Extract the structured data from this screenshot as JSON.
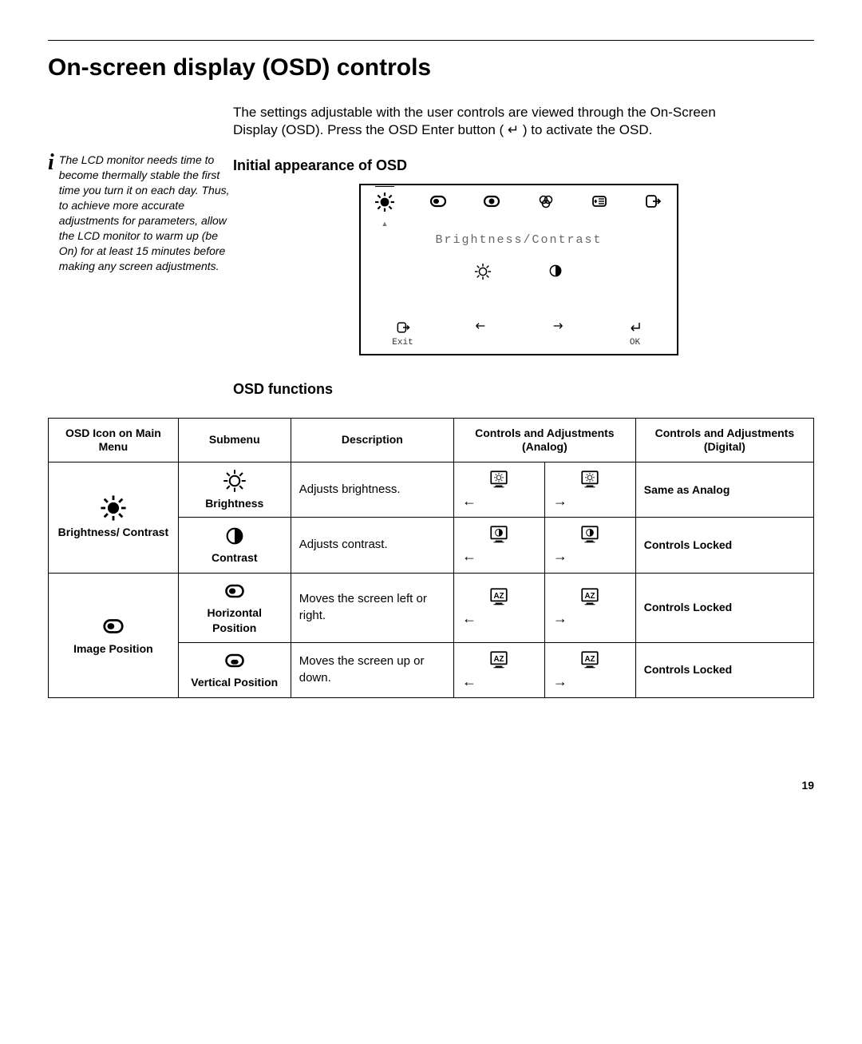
{
  "page": {
    "title": "On-screen display (OSD) controls",
    "intro": "The settings adjustable with the user controls are viewed through the On-Screen Display (OSD). Press the OSD Enter button ( ↵ ) to activate the OSD.",
    "note": "The LCD monitor needs time to become thermally stable the first time you turn it on each day. Thus, to achieve more accurate adjustments for parameters, allow the LCD monitor to warm up (be On) for at least 15 minutes before making any screen adjustments.",
    "sub1": "Initial appearance of OSD",
    "sub2": "OSD functions",
    "number": "19"
  },
  "osd_panel": {
    "title": "Brightness/Contrast",
    "tabs": [
      "brightness-icon",
      "hpos-icon",
      "image-setup-icon",
      "color-icon",
      "options-icon",
      "exit-icon"
    ],
    "mid_icons": [
      "sun-outline-icon",
      "contrast-icon"
    ],
    "bottom": [
      {
        "icon": "exit-icon",
        "label": "Exit"
      },
      {
        "icon": "arrow-left-icon",
        "label": ""
      },
      {
        "icon": "arrow-right-icon",
        "label": ""
      },
      {
        "icon": "enter-icon",
        "label": "OK"
      }
    ]
  },
  "table": {
    "headers": {
      "c1": "OSD Icon on Main Menu",
      "c2": "Submenu",
      "c3": "Description",
      "c4": "Controls and Adjustments (Analog)",
      "c5": "Controls and Adjustments (Digital)"
    },
    "rows": {
      "brightness_contrast_label": "Brightness/ Contrast",
      "brightness_sub": "Brightness",
      "brightness_desc": "Adjusts brightness.",
      "brightness_digital": "Same as Analog",
      "contrast_sub": "Contrast",
      "contrast_desc": "Adjusts contrast.",
      "contrast_digital": "Controls Locked",
      "image_position_label": "Image Position",
      "hpos_sub": "Horizontal Position",
      "hpos_desc": "Moves the screen left or right.",
      "hpos_digital": "Controls Locked",
      "vpos_sub": "Vertical Position",
      "vpos_desc": "Moves the screen up or down.",
      "vpos_digital": "Controls Locked"
    }
  }
}
